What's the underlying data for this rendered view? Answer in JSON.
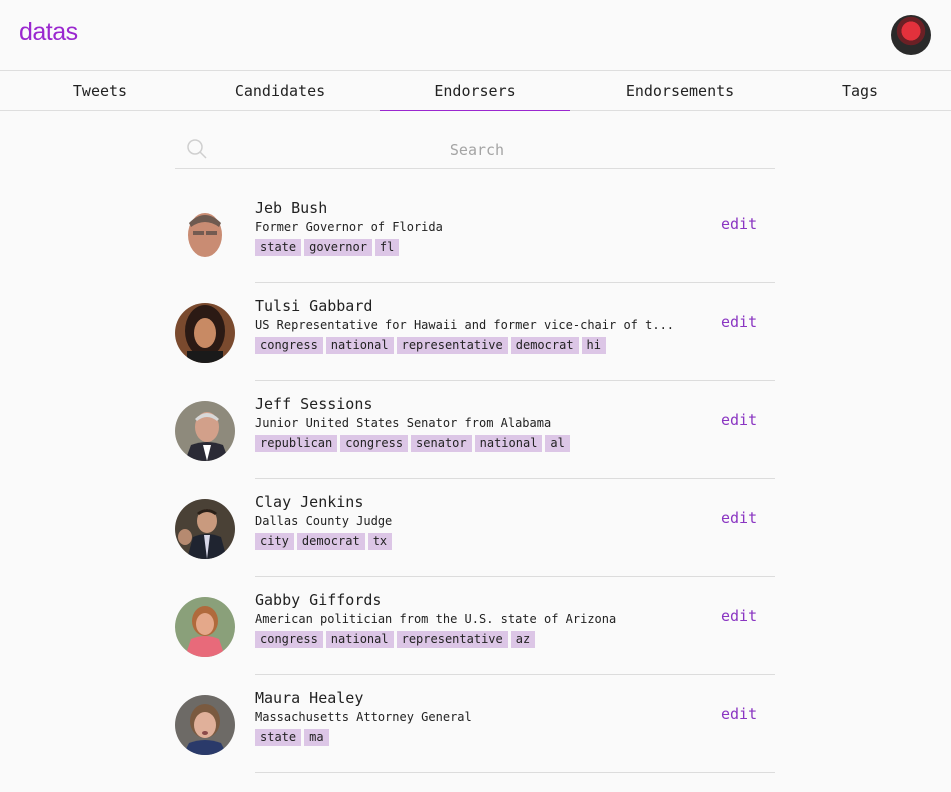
{
  "app": {
    "logo": "datas"
  },
  "nav": {
    "tabs": [
      {
        "label": "Tweets"
      },
      {
        "label": "Candidates"
      },
      {
        "label": "Endorsers"
      },
      {
        "label": "Endorsements"
      },
      {
        "label": "Tags"
      }
    ],
    "active": "Endorsers"
  },
  "search": {
    "placeholder": "Search",
    "value": ""
  },
  "endorsers": [
    {
      "name": "Jeb Bush",
      "description": "Former Governor of Florida",
      "tags": [
        "state",
        "governor",
        "fl"
      ],
      "action": "edit"
    },
    {
      "name": "Tulsi Gabbard",
      "description": "US Representative for Hawaii and former vice-chair of t...",
      "tags": [
        "congress",
        "national",
        "representative",
        "democrat",
        "hi"
      ],
      "action": "edit"
    },
    {
      "name": "Jeff Sessions",
      "description": "Junior United States Senator from Alabama",
      "tags": [
        "republican",
        "congress",
        "senator",
        "national",
        "al"
      ],
      "action": "edit"
    },
    {
      "name": "Clay Jenkins",
      "description": "Dallas County Judge",
      "tags": [
        "city",
        "democrat",
        "tx"
      ],
      "action": "edit"
    },
    {
      "name": "Gabby Giffords",
      "description": "American politician from the U.S. state of Arizona",
      "tags": [
        "congress",
        "national",
        "representative",
        "az"
      ],
      "action": "edit"
    },
    {
      "name": "Maura Healey",
      "description": "Massachusetts Attorney General",
      "tags": [
        "state",
        "ma"
      ],
      "action": "edit"
    }
  ],
  "colors": {
    "accent": "#9a27cf",
    "tag_bg": "#dcc6e6",
    "edit_link": "#8a35c2"
  }
}
